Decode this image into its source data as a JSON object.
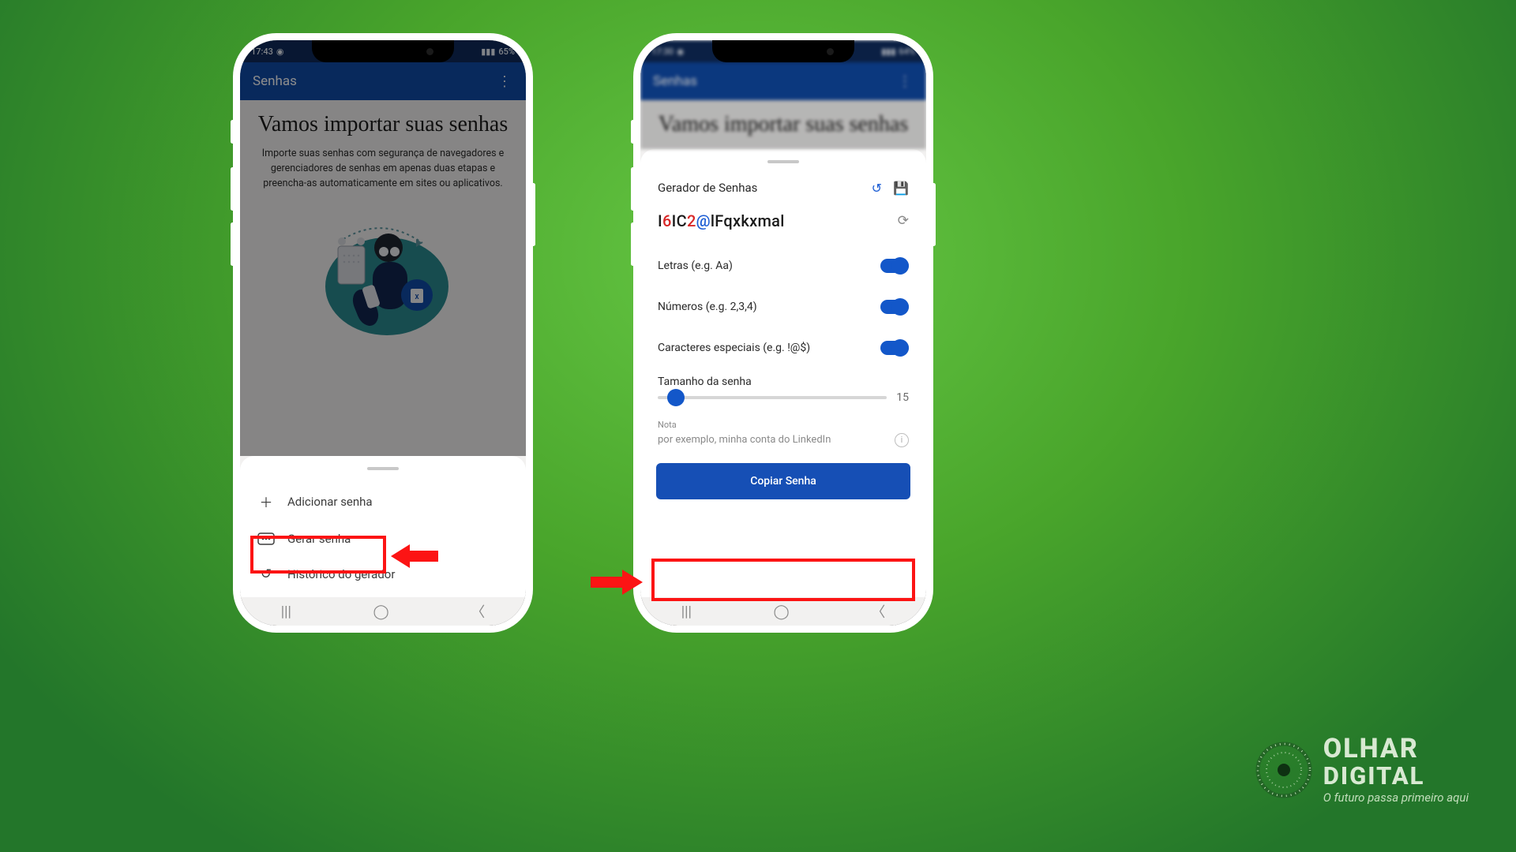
{
  "status": {
    "time": "17:43",
    "battery": "65%"
  },
  "status2": {
    "time": "17:30",
    "battery": "64%"
  },
  "appbar": {
    "title": "Senhas"
  },
  "hero": {
    "title": "Vamos importar suas senhas",
    "body": "Importe suas senhas com segurança de navegadores e gerenciadores de senhas em apenas duas etapas e preencha-as automaticamente em sites ou aplicativos."
  },
  "sheet1": {
    "add": "Adicionar senha",
    "gen": "Gerar senha",
    "hist": "Histórico do gerador"
  },
  "gen": {
    "title": "Gerador de Senhas",
    "password": "I6IC2@lFqxkxmal",
    "opt_letters": "Letras (e.g. Aa)",
    "opt_numbers": "Números (e.g. 2,3,4)",
    "opt_special": "Caracteres especiais (e.g. !@$)",
    "size_label": "Tamanho da senha",
    "size_value": "15",
    "note_label": "Nota",
    "note_placeholder": "por exemplo, minha conta do LinkedIn",
    "copy": "Copiar Senha"
  },
  "brand": {
    "l1": "OLHAR",
    "l2": "DIGITAL",
    "tag": "O futuro passa primeiro aqui"
  }
}
